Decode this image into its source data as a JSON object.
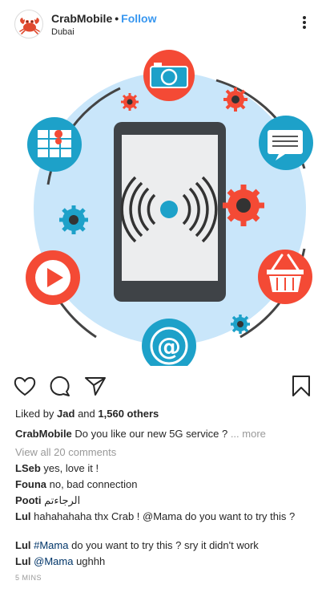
{
  "header": {
    "username": "CrabMobile",
    "separator": "•",
    "follow_label": "Follow",
    "location": "Dubai",
    "more_icon": "more-vertical-icon"
  },
  "image": {
    "bg_circle_color": "#c9e6fa",
    "accent_red": "#f44a35",
    "accent_teal": "#1da1c9",
    "phone_color": "#3f4347"
  },
  "actions": {
    "like_icon": "heart-icon",
    "comment_icon": "comment-icon",
    "share_icon": "send-icon",
    "save_icon": "bookmark-icon"
  },
  "likes": {
    "prefix": "Liked by",
    "user": "Jad",
    "and": "and",
    "others": "1,560 others"
  },
  "caption": {
    "user": "CrabMobile",
    "text": "Do you like our new 5G service ?",
    "more": "... more"
  },
  "view_all": "View all 20 comments",
  "comments": [
    {
      "user": "LSeb",
      "text": "yes, love it !"
    },
    {
      "user": "Founa",
      "text": "no, bad connection"
    },
    {
      "user": "Pooti",
      "text": "الرجاءتم"
    },
    {
      "user": "Lul",
      "text_before": "hahahahaha thx Crab ! @Mama do you want to try this ?"
    },
    {
      "user": "Lul",
      "tag": "#Mama",
      "text_after": "do you want to try this ? sry it didn't work"
    },
    {
      "user": "Lul",
      "tag": "@Mama",
      "text_after": "ughhh"
    }
  ],
  "timestamp": "5 MINS"
}
